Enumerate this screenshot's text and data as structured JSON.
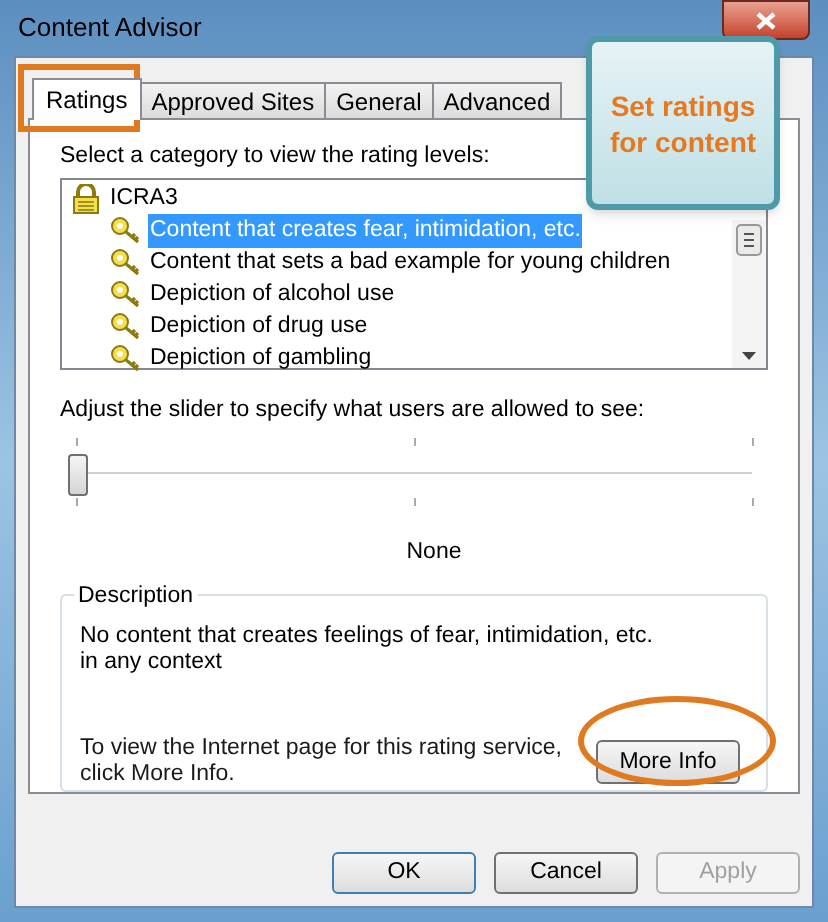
{
  "window": {
    "title": "Content Advisor"
  },
  "tabs": [
    {
      "label": "Ratings",
      "selected": true
    },
    {
      "label": "Approved Sites",
      "selected": false
    },
    {
      "label": "General",
      "selected": false
    },
    {
      "label": "Advanced",
      "selected": false
    }
  ],
  "callout": {
    "text": "Set ratings for content"
  },
  "category_prompt": "Select a category to view the rating levels:",
  "categories": [
    {
      "label": "ICRA3",
      "children": [
        {
          "label": "Content that creates fear, intimidation, etc.",
          "selected": true
        },
        {
          "label": "Content that sets a bad example for young children",
          "selected": false
        },
        {
          "label": "Depiction of alcohol use",
          "selected": false
        },
        {
          "label": "Depiction of drug use",
          "selected": false
        },
        {
          "label": "Depiction of gambling",
          "selected": false
        }
      ]
    }
  ],
  "slider_prompt": "Adjust the slider to specify what users are allowed to see:",
  "slider": {
    "level": 0,
    "reading": "None"
  },
  "description": {
    "heading": "Description",
    "text": "No content that creates feelings of fear, intimidation, etc. in any context",
    "info_text": "To view the Internet page for this rating service, click More Info.",
    "button": "More Info"
  },
  "buttons": [
    {
      "label": "OK",
      "default": true,
      "disabled": false
    },
    {
      "label": "Cancel",
      "default": false,
      "disabled": false
    },
    {
      "label": "Apply",
      "default": false,
      "disabled": true
    }
  ]
}
